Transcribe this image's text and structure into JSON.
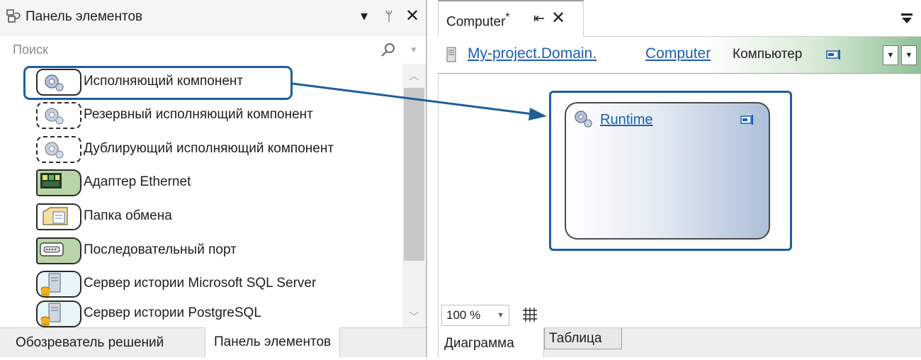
{
  "toolbox": {
    "title": "Панель элементов",
    "search_placeholder": "Поиск",
    "items": [
      {
        "label": "Исполняющий компонент",
        "icon": "gear-runtime-icon",
        "selected": true
      },
      {
        "label": "Резервный исполняющий компонент",
        "icon": "gear-runtime-dashed-icon"
      },
      {
        "label": "Дублирующий исполняющий компонент",
        "icon": "gear-runtime-dashed-icon"
      },
      {
        "label": "Адаптер Ethernet",
        "icon": "network-card-icon"
      },
      {
        "label": "Папка обмена",
        "icon": "folder-icon"
      },
      {
        "label": "Последовательный порт",
        "icon": "serial-port-icon"
      },
      {
        "label": "Сервер истории Microsoft SQL Server",
        "icon": "database-server-icon"
      },
      {
        "label": "Сервер истории PostgreSQL",
        "icon": "database-server-icon"
      }
    ],
    "tabs": [
      "Обозреватель решений",
      "Панель элементов"
    ]
  },
  "document": {
    "tab_label": "Computer",
    "tab_modified_mark": "*",
    "breadcrumb": {
      "namespace": "My-project.Domain.",
      "name": "Computer",
      "caption": "Компьютер"
    },
    "node": {
      "label": "Runtime"
    },
    "zoom": "100 %",
    "bottom_tabs": [
      "Диаграмма",
      "Таблица"
    ]
  },
  "colors": {
    "accent": "#1e5f99",
    "link": "#1a5fb4",
    "green_gradient_end": "#8fc197",
    "node_gradient_end": "#aebfd9"
  }
}
